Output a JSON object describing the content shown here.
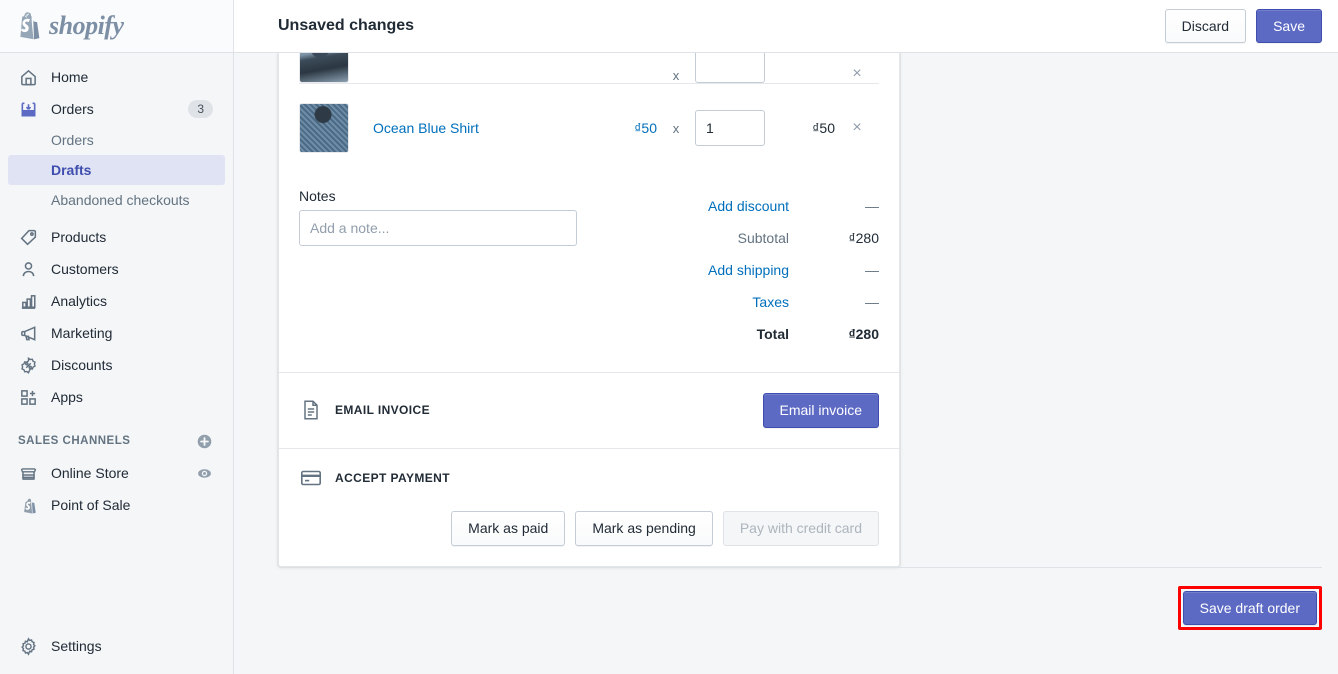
{
  "brand": {
    "name": "shopify",
    "logo_icon": "shopify-bag-icon",
    "accent_color": "#5c6ac4",
    "link_color": "#006fbb",
    "sidebar_bg": "#f4f6f8"
  },
  "sidebar": {
    "items": [
      {
        "label": "Home",
        "icon": "home-icon",
        "badge": ""
      },
      {
        "label": "Orders",
        "icon": "orders-inbox-icon",
        "badge": "3"
      },
      {
        "label": "Products",
        "icon": "products-tag-icon",
        "badge": ""
      },
      {
        "label": "Customers",
        "icon": "customers-person-icon",
        "badge": ""
      },
      {
        "label": "Analytics",
        "icon": "analytics-bars-icon",
        "badge": ""
      },
      {
        "label": "Marketing",
        "icon": "marketing-megaphone-icon",
        "badge": ""
      },
      {
        "label": "Discounts",
        "icon": "discounts-percent-icon",
        "badge": ""
      },
      {
        "label": "Apps",
        "icon": "apps-grid-icon",
        "badge": ""
      }
    ],
    "orders_subitems": [
      {
        "label": "Orders",
        "active": false
      },
      {
        "label": "Drafts",
        "active": true
      },
      {
        "label": "Abandoned checkouts",
        "active": false
      }
    ],
    "sales_channels": {
      "title": "SALES CHANNELS",
      "add_icon": "plus-circle-icon",
      "items": [
        {
          "label": "Online Store",
          "icon": "store-icon",
          "trailing_icon": "eye-icon"
        },
        {
          "label": "Point of Sale",
          "icon": "pos-shopify-bag-icon",
          "trailing_icon": ""
        }
      ]
    },
    "settings": {
      "label": "Settings",
      "icon": "gear-icon"
    }
  },
  "topbar": {
    "title": "Unsaved changes",
    "discard_label": "Discard",
    "save_label": "Save"
  },
  "order": {
    "line_items": [
      {
        "name": "",
        "price": "",
        "multiply": "x",
        "quantity": "",
        "line_total": "",
        "remove_icon": "close-icon",
        "thumb": "product-thumb-partial",
        "partial": true
      },
      {
        "name": "Ocean Blue Shirt",
        "price": "₫50",
        "multiply": "x",
        "quantity": "1",
        "line_total": "₫50",
        "remove_icon": "close-icon",
        "thumb": "product-thumb-ocean-blue-shirt",
        "partial": false
      }
    ],
    "notes": {
      "label": "Notes",
      "value": "",
      "placeholder": "Add a note..."
    },
    "totals": [
      {
        "label": "Add discount",
        "value": "—",
        "link": true,
        "bold": false
      },
      {
        "label": "Subtotal",
        "value": "₫280",
        "link": false,
        "bold": false
      },
      {
        "label": "Add shipping",
        "value": "—",
        "link": true,
        "bold": false
      },
      {
        "label": "Taxes",
        "value": "—",
        "link": true,
        "bold": false
      },
      {
        "label": "Total",
        "value": "₫280",
        "link": false,
        "bold": true
      }
    ],
    "email_invoice": {
      "icon": "invoice-document-icon",
      "title": "EMAIL INVOICE",
      "button_label": "Email invoice"
    },
    "accept_payment": {
      "icon": "credit-card-icon",
      "title": "ACCEPT PAYMENT",
      "buttons": [
        {
          "label": "Mark as paid",
          "disabled": false
        },
        {
          "label": "Mark as pending",
          "disabled": false
        },
        {
          "label": "Pay with credit card",
          "disabled": true
        }
      ]
    },
    "footer": {
      "save_draft_label": "Save draft order",
      "highlight_color": "#ff0000"
    }
  }
}
